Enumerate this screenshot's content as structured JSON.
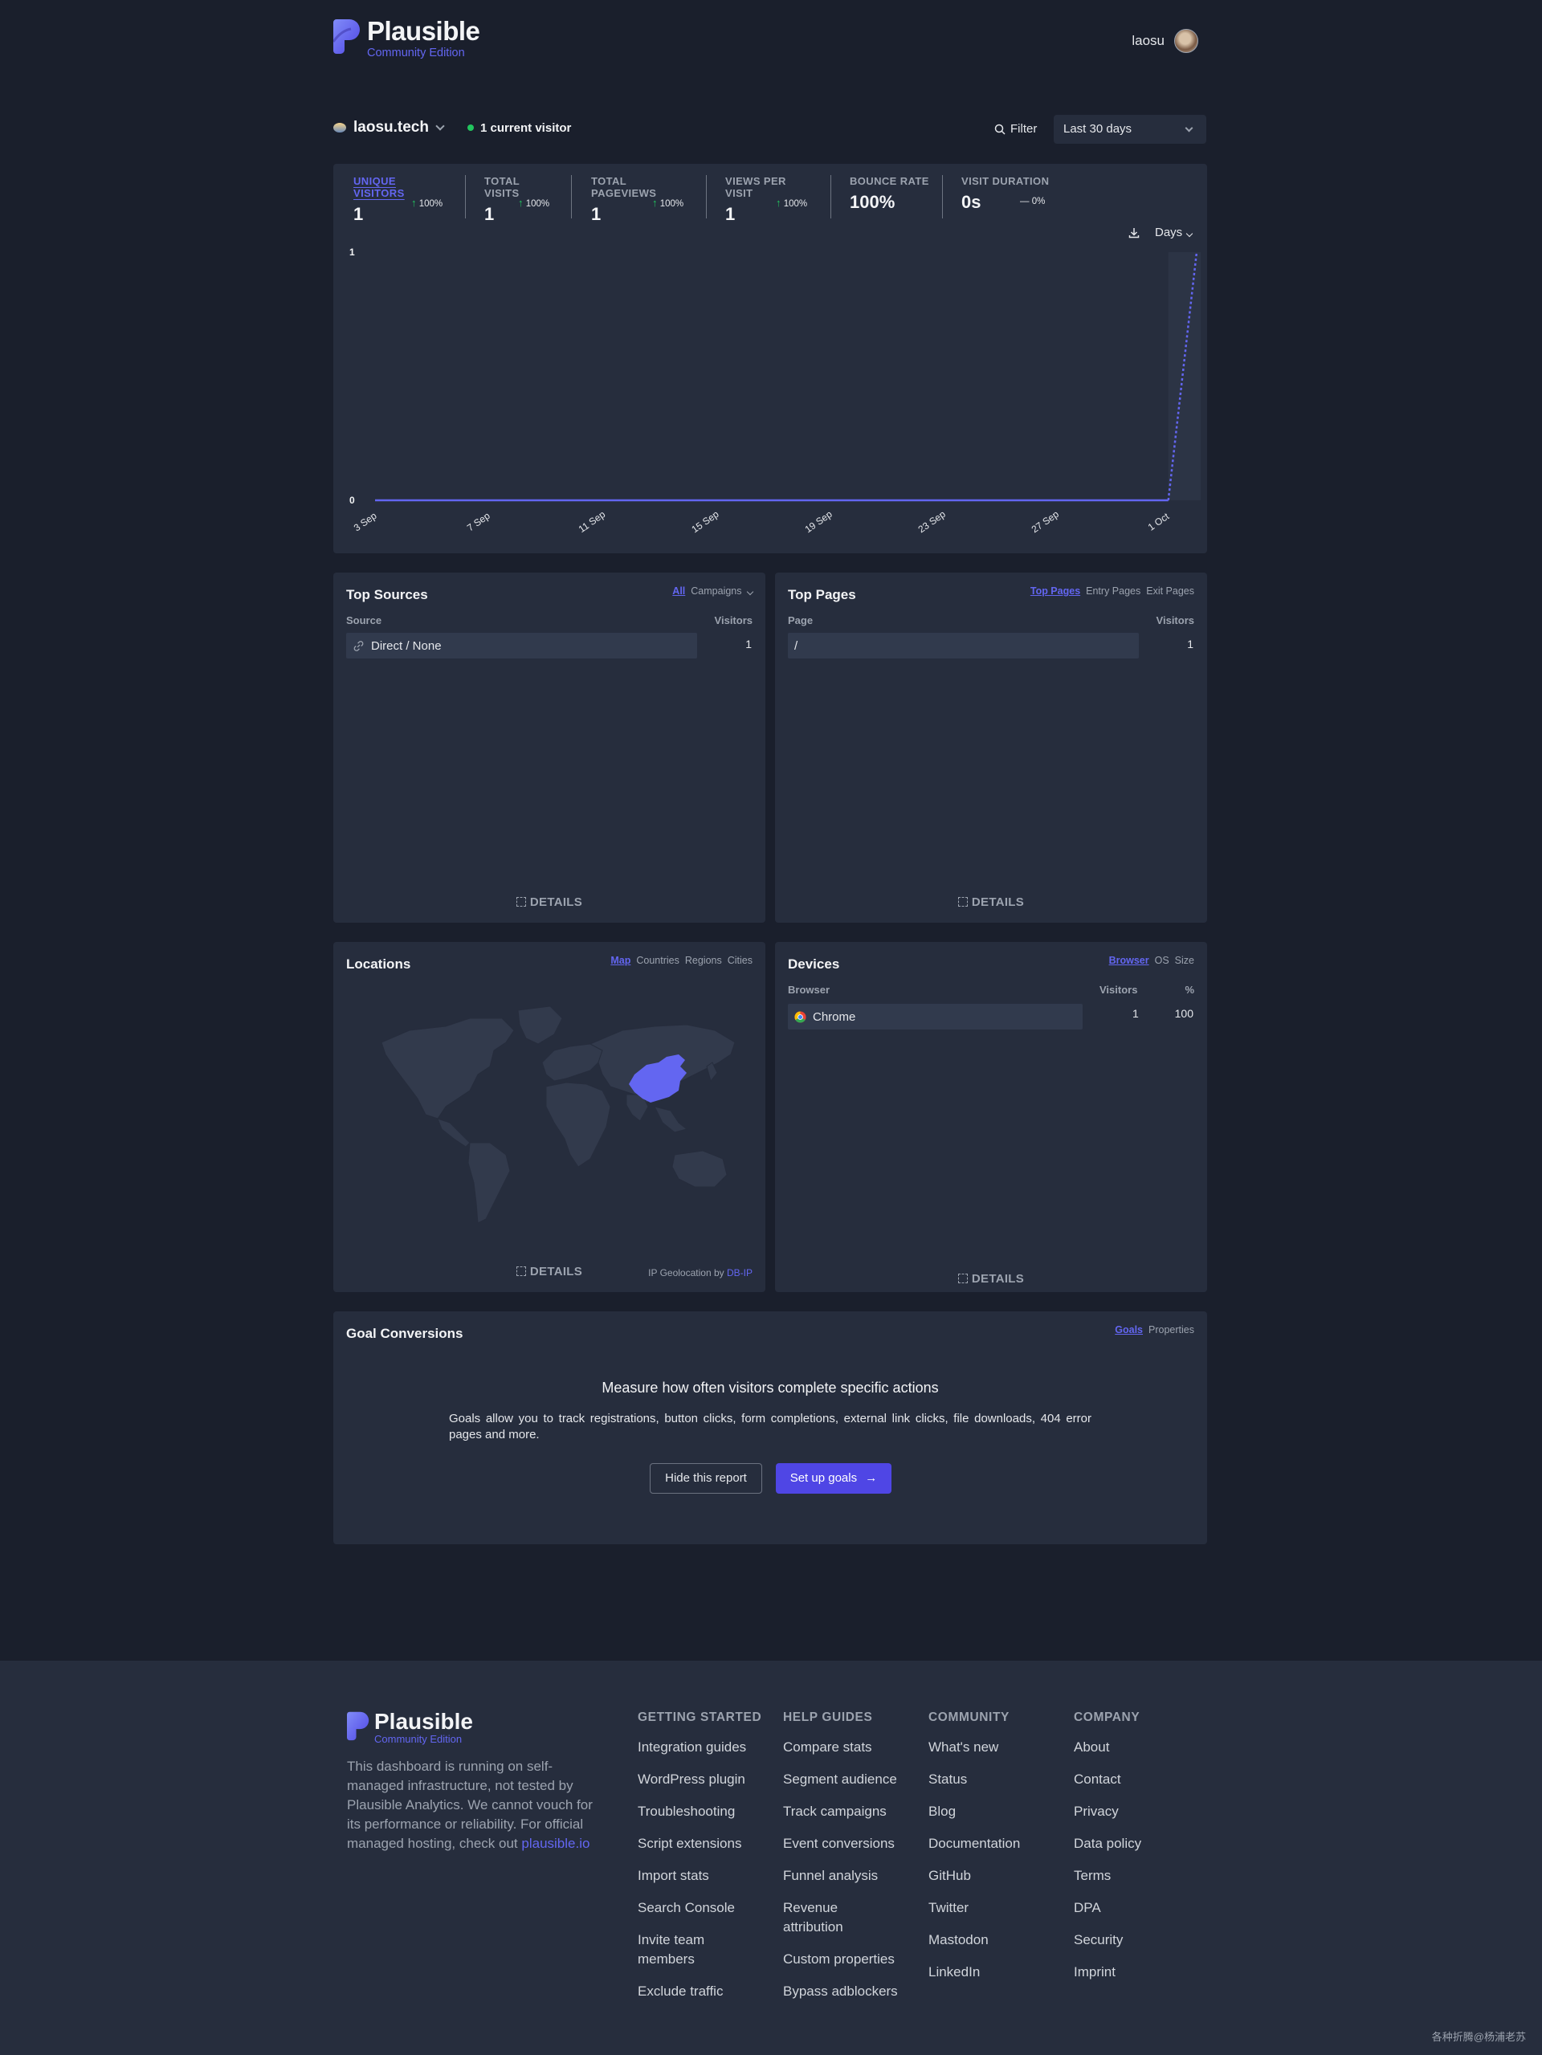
{
  "header": {
    "brand": "Plausible",
    "edition": "Community Edition",
    "username": "laosu"
  },
  "sitebar": {
    "site": "laosu.tech",
    "current_visitors": "1 current visitor",
    "filter_label": "Filter",
    "date_range": "Last 30 days"
  },
  "metrics": [
    {
      "label": "UNIQUE VISITORS",
      "value": "1",
      "change": "100%",
      "active": true
    },
    {
      "label": "TOTAL VISITS",
      "value": "1",
      "change": "100%"
    },
    {
      "label": "TOTAL PAGEVIEWS",
      "value": "1",
      "change": "100%"
    },
    {
      "label": "VIEWS PER VISIT",
      "value": "1",
      "change": "100%"
    },
    {
      "label": "BOUNCE RATE",
      "value": "100%",
      "change": ""
    },
    {
      "label": "VISIT DURATION",
      "value": "0s",
      "change": "0%"
    }
  ],
  "chart_controls": {
    "interval": "Days"
  },
  "chart_data": {
    "type": "line",
    "title": "",
    "xlabel": "",
    "ylabel": "",
    "ylim": [
      0,
      1
    ],
    "y_ticks": [
      "0",
      "1"
    ],
    "x_ticks": [
      "3 Sep",
      "7 Sep",
      "11 Sep",
      "15 Sep",
      "19 Sep",
      "23 Sep",
      "27 Sep",
      "1 Oct"
    ],
    "x": [
      "3 Sep",
      "4 Sep",
      "5 Sep",
      "6 Sep",
      "7 Sep",
      "8 Sep",
      "9 Sep",
      "10 Sep",
      "11 Sep",
      "12 Sep",
      "13 Sep",
      "14 Sep",
      "15 Sep",
      "16 Sep",
      "17 Sep",
      "18 Sep",
      "19 Sep",
      "20 Sep",
      "21 Sep",
      "22 Sep",
      "23 Sep",
      "24 Sep",
      "25 Sep",
      "26 Sep",
      "27 Sep",
      "28 Sep",
      "29 Sep",
      "30 Sep",
      "1 Oct",
      "2 Oct"
    ],
    "series": [
      {
        "values": [
          0,
          0,
          0,
          0,
          0,
          0,
          0,
          0,
          0,
          0,
          0,
          0,
          0,
          0,
          0,
          0,
          0,
          0,
          0,
          0,
          0,
          0,
          0,
          0,
          0,
          0,
          0,
          0,
          0,
          1
        ]
      }
    ],
    "color": "#6366f1",
    "grid": false
  },
  "top_sources": {
    "title": "Top Sources",
    "tabs": [
      "All",
      "Campaigns"
    ],
    "col_source": "Source",
    "col_visitors": "Visitors",
    "rows": [
      {
        "label": "Direct / None",
        "visitors": "1"
      }
    ],
    "details": "DETAILS"
  },
  "top_pages": {
    "title": "Top Pages",
    "tabs": [
      "Top Pages",
      "Entry Pages",
      "Exit Pages"
    ],
    "col_page": "Page",
    "col_visitors": "Visitors",
    "rows": [
      {
        "label": "/",
        "visitors": "1"
      }
    ],
    "details": "DETAILS"
  },
  "locations": {
    "title": "Locations",
    "tabs": [
      "Map",
      "Countries",
      "Regions",
      "Cities"
    ],
    "details": "DETAILS",
    "geo_prefix": "IP Geolocation by",
    "geo_link": "DB-IP"
  },
  "devices": {
    "title": "Devices",
    "tabs": [
      "Browser",
      "OS",
      "Size"
    ],
    "col_browser": "Browser",
    "col_visitors": "Visitors",
    "col_percent": "%",
    "rows": [
      {
        "label": "Chrome",
        "visitors": "1",
        "percent": "100"
      }
    ],
    "details": "DETAILS"
  },
  "goals": {
    "title": "Goal Conversions",
    "tabs": [
      "Goals",
      "Properties"
    ],
    "heading": "Measure how often visitors complete specific actions",
    "body": "Goals allow you to track registrations, button clicks, form completions, external link clicks, file downloads, 404 error pages and more.",
    "hide_button": "Hide this report",
    "setup_button": "Set up goals"
  },
  "footer": {
    "brand": "Plausible",
    "edition": "Community Edition",
    "desc": "This dashboard is running on self-managed infrastructure, not tested by Plausible Analytics. We cannot vouch for its performance or reliability. For official managed hosting, check out",
    "desc_link": "plausible.io",
    "columns": [
      {
        "title": "GETTING STARTED",
        "links": [
          "Integration guides",
          "WordPress plugin",
          "Troubleshooting",
          "Script extensions",
          "Import stats",
          "Search Console",
          "Invite team members",
          "Exclude traffic"
        ]
      },
      {
        "title": "HELP GUIDES",
        "links": [
          "Compare stats",
          "Segment audience",
          "Track campaigns",
          "Event conversions",
          "Funnel analysis",
          "Revenue attribution",
          "Custom properties",
          "Bypass adblockers"
        ]
      },
      {
        "title": "COMMUNITY",
        "links": [
          "What's new",
          "Status",
          "Blog",
          "Documentation",
          "GitHub",
          "Twitter",
          "Mastodon",
          "LinkedIn"
        ]
      },
      {
        "title": "COMPANY",
        "links": [
          "About",
          "Contact",
          "Privacy",
          "Data policy",
          "Terms",
          "DPA",
          "Security",
          "Imprint"
        ]
      }
    ]
  },
  "watermark": "各种折腾@杨浦老苏"
}
